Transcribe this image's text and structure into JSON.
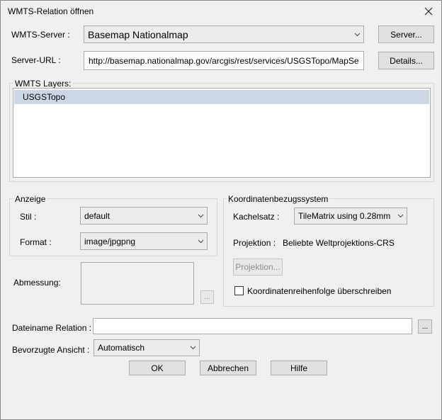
{
  "window": {
    "title": "WMTS-Relation öffnen"
  },
  "server": {
    "label": "WMTS-Server :",
    "value": "Basemap Nationalmap",
    "button": "Server..."
  },
  "url": {
    "label": "Server-URL :",
    "value": "http://basemap.nationalmap.gov/arcgis/rest/services/USGSTopo/MapSe",
    "button": "Details..."
  },
  "layers": {
    "title": "WMTS Layers:",
    "items": [
      "USGSTopo"
    ]
  },
  "anzeige": {
    "title": "Anzeige",
    "stil_label": "Stil :",
    "stil_value": "default",
    "format_label": "Format :",
    "format_value": "image/jpgpng"
  },
  "dimension": {
    "label": "Abmessung:",
    "browse_button": "..."
  },
  "crs": {
    "title": "Koordinatenbezugssystem",
    "kachelsatz_label": "Kachelsatz :",
    "kachelsatz_value": "TileMatrix using 0.28mm",
    "projektion_label": "Projektion :",
    "projektion_value": "Beliebte Weltprojektions-CRS",
    "projektion_button": "Projektion...",
    "override_checkbox_label": "Koordinatenreihenfolge überschreiben",
    "override_checked": false
  },
  "filename": {
    "label": "Dateiname Relation :",
    "value": "",
    "browse_button": "..."
  },
  "view": {
    "label": "Bevorzugte Ansicht :",
    "value": "Automatisch"
  },
  "buttons": {
    "ok": "OK",
    "cancel": "Abbrechen",
    "help": "Hilfe"
  }
}
